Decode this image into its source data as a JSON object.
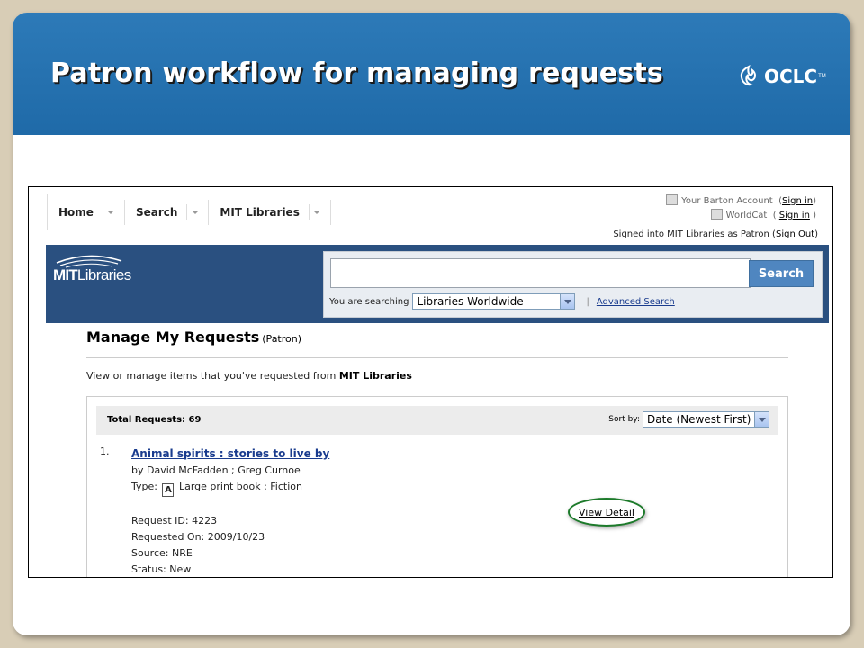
{
  "slide": {
    "title": "Patron workflow for managing requests",
    "logo_text": "OCLC",
    "logo_tm": "TM",
    "colors": {
      "header": "#1f6aa8",
      "frame": "#d8cdb6",
      "highlight_ring": "#1c7a2a"
    }
  },
  "app": {
    "nav": [
      {
        "label": "Home"
      },
      {
        "label": "Search"
      },
      {
        "label": "MIT Libraries"
      }
    ],
    "account": {
      "barton_label": "Your Barton Account",
      "worldcat_label": "WorldCat",
      "sign_in": "Sign in",
      "signed_in_prefix": "Signed into MIT Libraries as Patron (",
      "sign_out": "Sign Out",
      "signed_in_suffix": ")"
    },
    "logo": {
      "bold": "MIT",
      "rest": "Libraries"
    },
    "search": {
      "value": "",
      "button": "Search",
      "searching_label": "You are searching",
      "scope": "Libraries Worldwide",
      "separator": "|",
      "advanced": "Advanced Search"
    },
    "page": {
      "title": "Manage My Requests",
      "role": "(Patron)",
      "intro_prefix": "View or manage items that you've requested from ",
      "intro_library": "MIT Libraries",
      "total": "Total Requests: 69",
      "sort_label": "Sort by:",
      "sort_value": "Date (Newest First)"
    },
    "results": [
      {
        "number": "1.",
        "title": "Animal spirits : stories to live by",
        "authors": "by David McFadden ; Greg Curnoe",
        "type_label": "Type:",
        "type_icon": "large-print-icon",
        "type_value": "Large print book : Fiction",
        "request_id": "Request ID: 4223",
        "requested_on": "Requested On: 2009/10/23",
        "source": "Source: NRE",
        "status": "Status: New",
        "view_detail": "View Detail"
      }
    ]
  }
}
